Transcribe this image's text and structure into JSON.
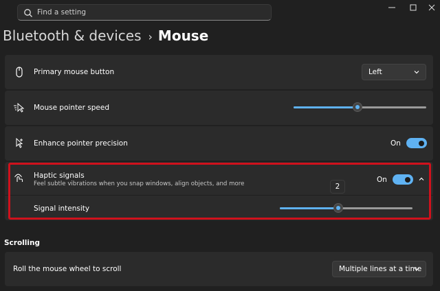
{
  "search": {
    "placeholder": "Find a setting",
    "icon": "search-icon"
  },
  "window_controls": [
    "minimize",
    "maximize",
    "close"
  ],
  "breadcrumb": {
    "parent": "Bluetooth & devices",
    "separator": "›",
    "current": "Mouse"
  },
  "settings": {
    "primary_button": {
      "label": "Primary mouse button",
      "value": "Left"
    },
    "pointer_speed": {
      "label": "Mouse pointer speed",
      "level": 0.48
    },
    "pointer_precision": {
      "label": "Enhance pointer precision",
      "state": "On"
    },
    "haptic": {
      "label": "Haptic signals",
      "description": "Feel subtle vibrations when you snap windows, align objects, and more",
      "state": "On",
      "intensity_label": "Signal intensity",
      "intensity_tooltip": "2",
      "intensity_level": 0.44
    }
  },
  "scrolling": {
    "heading": "Scrolling",
    "wheel_label": "Roll the mouse wheel to scroll",
    "wheel_value": "Multiple lines at a time"
  },
  "colors": {
    "accent": "#5fb2f2",
    "highlight": "#d0111c",
    "background": "#202020",
    "card": "#2b2b2b"
  }
}
